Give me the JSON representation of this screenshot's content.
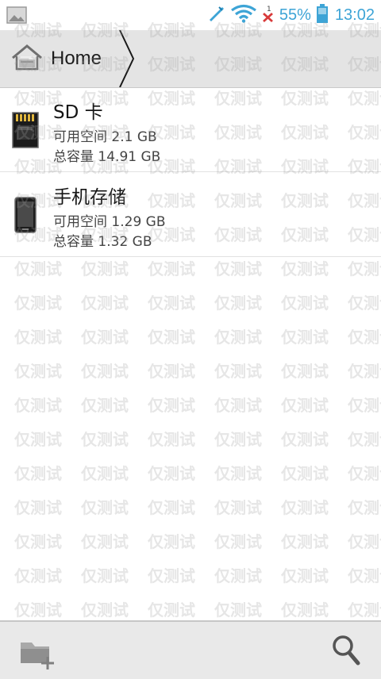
{
  "status_bar": {
    "battery_percent": "55%",
    "time": "13:02",
    "accent_color": "#3da4d6",
    "icons": [
      "image-icon",
      "signal-icon",
      "wifi-icon",
      "sim-missing-icon",
      "battery-icon"
    ]
  },
  "breadcrumb": {
    "home_label": "Home"
  },
  "storage": [
    {
      "name": "SD 卡",
      "free": "可用空间 2.1 GB",
      "total": "总容量 14.91 GB",
      "icon": "sd-card-icon"
    },
    {
      "name": "手机存储",
      "free": "可用空间 1.29 GB",
      "total": "总容量 1.32 GB",
      "icon": "phone-storage-icon"
    }
  ],
  "watermark": {
    "text": "仅测试"
  },
  "bottom_bar": {
    "icons": [
      "new-folder-icon",
      "search-icon"
    ]
  }
}
